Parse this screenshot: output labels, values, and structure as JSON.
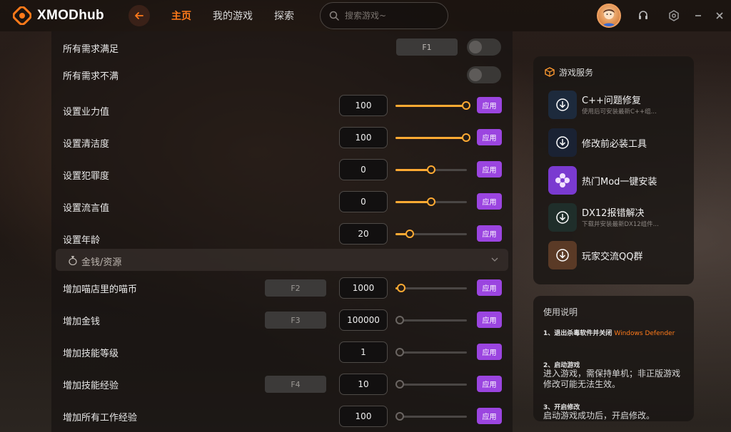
{
  "app": {
    "name": "XMODhub",
    "accent": "#ff7a1a",
    "apply_color": "#9b45e0"
  },
  "nav": {
    "home": "主页",
    "my_games": "我的游戏",
    "explore": "探索"
  },
  "search": {
    "placeholder": "搜索游戏~"
  },
  "toolbar_icons": [
    "headset-icon",
    "settings-icon",
    "minimize-icon",
    "close-icon"
  ],
  "cheats_top": [
    {
      "label": "所有需求满足",
      "hotkey": "F1",
      "type": "toggle",
      "on": false
    },
    {
      "label": "所有需求不满",
      "type": "toggle",
      "on": false
    },
    {
      "label": "设置业力值",
      "value": "100",
      "level": 1.0,
      "apply": "应用"
    },
    {
      "label": "设置清洁度",
      "value": "100",
      "level": 1.0,
      "apply": "应用"
    },
    {
      "label": "设置犯罪度",
      "value": "0",
      "level": 0.5,
      "apply": "应用"
    },
    {
      "label": "设置流言值",
      "value": "0",
      "level": 0.5,
      "apply": "应用"
    },
    {
      "label": "设置年龄",
      "value": "20",
      "level": 0.2,
      "apply": "应用"
    }
  ],
  "section": {
    "title": "金钱/资源"
  },
  "cheats_money": [
    {
      "label": "增加喵店里的喵币",
      "hotkey": "F2",
      "value": "1000",
      "level": 0.08,
      "apply": "应用"
    },
    {
      "label": "增加金钱",
      "hotkey": "F3",
      "value": "100000",
      "level": 0.0,
      "apply": "应用"
    },
    {
      "label": "增加技能等级",
      "value": "1",
      "level": 0.0,
      "apply": "应用"
    },
    {
      "label": "增加技能经验",
      "hotkey": "F4",
      "value": "10",
      "level": 0.0,
      "apply": "应用"
    },
    {
      "label": "增加所有工作经验",
      "value": "100",
      "level": 0.0,
      "apply": "应用"
    }
  ],
  "services": {
    "title": "游戏服务",
    "items": [
      {
        "name": "C++问题修复",
        "desc": "使用后可安装最新C++组...",
        "color": "#1d2a3c"
      },
      {
        "name": "修改前必装工具",
        "desc": "",
        "color": "#1a2233"
      },
      {
        "name": "热门Mod一键安装",
        "desc": "",
        "color": "#7a3ad0"
      },
      {
        "name": "DX12报错解决",
        "desc": "下载并安装最新DX12组件...",
        "color": "#1f2e2a"
      },
      {
        "name": "玩家交流QQ群",
        "desc": "",
        "color": "#5a3a26"
      }
    ]
  },
  "guide": {
    "title": "使用说明",
    "step1_head": "1、退出杀毒软件并关闭",
    "step1_highlight": "Windows Defender",
    "step2_head": "2、启动游戏",
    "step2_body": "进入游戏，需保持单机；非正版游戏修改可能无法生效。",
    "step3_head": "3、开启修改",
    "step3_body": "启动游戏成功后，开启修改。"
  }
}
